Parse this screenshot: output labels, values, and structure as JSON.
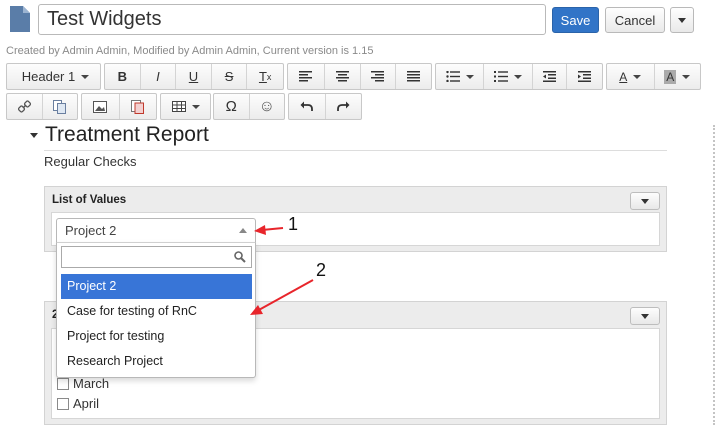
{
  "header": {
    "title_value": "Test Widgets",
    "save_label": "Save",
    "cancel_label": "Cancel"
  },
  "meta": {
    "text": "Created by Admin Admin, Modified by Admin Admin, Current version is 1.15"
  },
  "toolbar": {
    "format_select": "Header 1",
    "bold": "B",
    "italic": "I",
    "underline": "U",
    "strike": "S",
    "clear_format": "T",
    "clear_format_sub": "x",
    "font_color": "A",
    "bg_color": "A",
    "omega": "Ω",
    "smiley": "☺"
  },
  "section": {
    "title": "Treatment Report",
    "subtitle": "Regular Checks"
  },
  "panel1": {
    "heading": "List of Values",
    "selected_value": "Project 2"
  },
  "dropdown": {
    "options": [
      "Project 2",
      "Case for testing of RnC",
      "Project for testing",
      "Research Project"
    ]
  },
  "panel2": {
    "heading_partial": "2",
    "months": [
      "March",
      "April"
    ]
  },
  "annotations": {
    "one": "1",
    "two": "2",
    "arrow_color": "#e8252b"
  },
  "colors": {
    "primary_button": "#3174c7",
    "selected_option": "#3875d7"
  }
}
